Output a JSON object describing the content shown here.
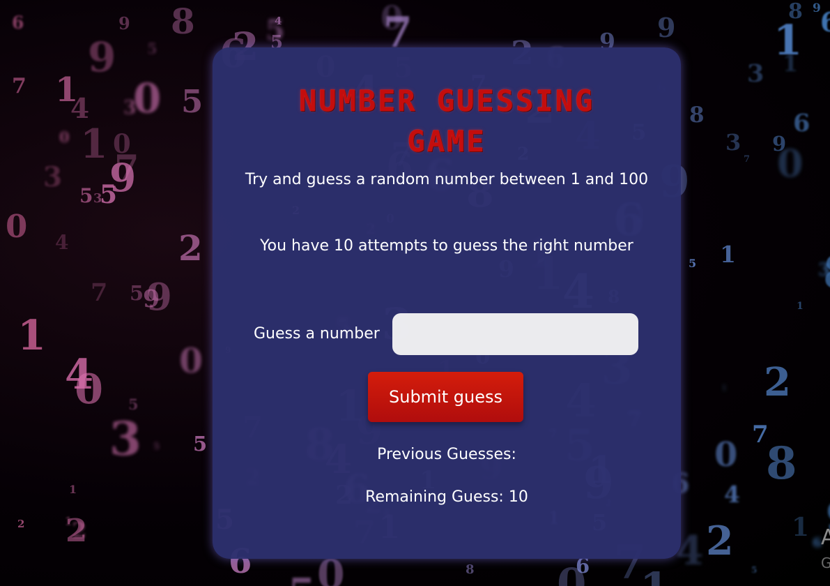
{
  "game": {
    "title": "NUMBER GUESSING GAME",
    "intro": "Try and guess a random number between 1 and 100",
    "attempts_info": "You have 10 attempts to guess the right number",
    "guess_label": "Guess a number",
    "guess_value": "",
    "submit_label": "Submit guess",
    "previous_guesses": "Previous Guesses:",
    "remaining": "Remaining Guess: 10"
  },
  "corner_text": {
    "line1": "A",
    "line2": "G"
  },
  "colors": {
    "card_bg": "#2d306e",
    "title_red": "#c40d0d",
    "button_red": "#c9150c"
  }
}
